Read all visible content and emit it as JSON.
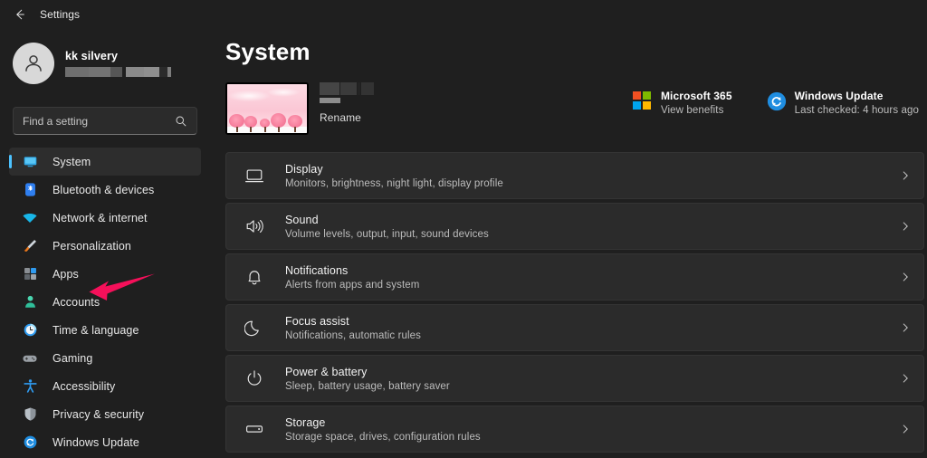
{
  "window": {
    "title": "Settings",
    "back_icon": "back-arrow-icon"
  },
  "sidebar": {
    "account": {
      "name": "kk silvery",
      "email_redacted": true,
      "avatar_icon": "person-avatar-icon"
    },
    "search": {
      "placeholder": "Find a setting",
      "value": "",
      "icon": "search-icon"
    },
    "items": [
      {
        "label": "System",
        "icon": "monitor-icon",
        "active": true
      },
      {
        "label": "Bluetooth & devices",
        "icon": "bluetooth-icon",
        "active": false
      },
      {
        "label": "Network & internet",
        "icon": "wifi-icon",
        "active": false
      },
      {
        "label": "Personalization",
        "icon": "paintbrush-icon",
        "active": false
      },
      {
        "label": "Apps",
        "icon": "apps-grid-icon",
        "active": false
      },
      {
        "label": "Accounts",
        "icon": "person-icon",
        "active": false
      },
      {
        "label": "Time & language",
        "icon": "clock-icon",
        "active": false
      },
      {
        "label": "Gaming",
        "icon": "gamepad-icon",
        "active": false
      },
      {
        "label": "Accessibility",
        "icon": "accessibility-icon",
        "active": false
      },
      {
        "label": "Privacy & security",
        "icon": "shield-icon",
        "active": false
      },
      {
        "label": "Windows Update",
        "icon": "sync-icon",
        "active": false
      }
    ]
  },
  "main": {
    "page_title": "System",
    "device": {
      "thumbnail_icon": "wallpaper-thumbnail-cherry-blossom",
      "name_redacted": true,
      "rename_label": "Rename"
    },
    "status_cards": [
      {
        "icon": "microsoft-logo-icon",
        "title": "Microsoft 365",
        "subtitle": "View benefits"
      },
      {
        "icon": "windows-update-sync-icon",
        "title": "Windows Update",
        "subtitle": "Last checked: 4 hours ago"
      }
    ],
    "rows": [
      {
        "icon": "display-monitor-icon",
        "title": "Display",
        "subtitle": "Monitors, brightness, night light, display profile",
        "chevron": "chevron-right-icon"
      },
      {
        "icon": "speaker-icon",
        "title": "Sound",
        "subtitle": "Volume levels, output, input, sound devices",
        "chevron": "chevron-right-icon"
      },
      {
        "icon": "bell-icon",
        "title": "Notifications",
        "subtitle": "Alerts from apps and system",
        "chevron": "chevron-right-icon"
      },
      {
        "icon": "moon-icon",
        "title": "Focus assist",
        "subtitle": "Notifications, automatic rules",
        "chevron": "chevron-right-icon"
      },
      {
        "icon": "power-icon",
        "title": "Power & battery",
        "subtitle": "Sleep, battery usage, battery saver",
        "chevron": "chevron-right-icon"
      },
      {
        "icon": "drive-icon",
        "title": "Storage",
        "subtitle": "Storage space, drives, configuration rules",
        "chevron": "chevron-right-icon"
      }
    ]
  },
  "annotation": {
    "arrow_icon": "pointer-arrow-icon",
    "arrow_color": "#f5105a",
    "points_at": "Accounts"
  },
  "colors": {
    "background": "#1f1f1f",
    "card": "#2b2b2b",
    "accent": "#4cc2ff",
    "text_primary": "#f2f2f2",
    "text_secondary": "#bcbcbc",
    "annotation": "#f5105a"
  }
}
